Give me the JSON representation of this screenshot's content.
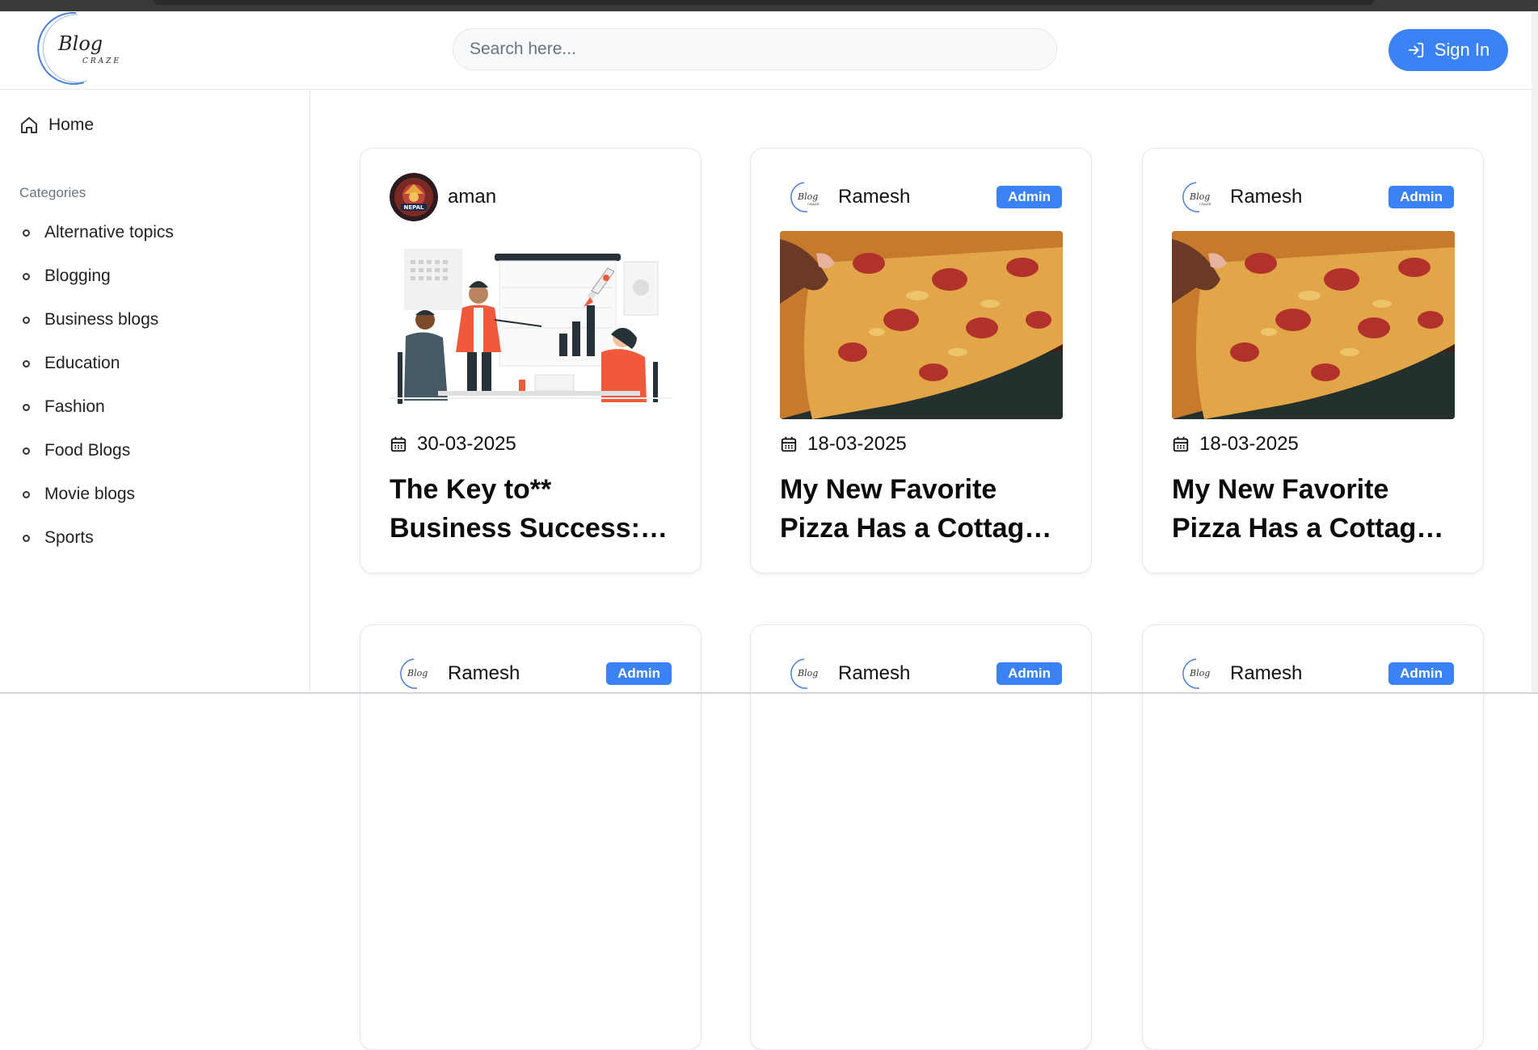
{
  "header": {
    "logo_text": "Blog",
    "logo_sub": "CRAZE",
    "search_placeholder": "Search here...",
    "signin_label": "Sign In"
  },
  "sidebar": {
    "home_label": "Home",
    "categories_title": "Categories",
    "categories": [
      "Alternative topics",
      "Blogging",
      "Business blogs",
      "Education",
      "Fashion",
      "Food Blogs",
      "Movie blogs",
      "Sports"
    ]
  },
  "posts": [
    {
      "author": "aman",
      "badge": "",
      "date": "30-03-2025",
      "title": "The Key to** Business Success: Strategies for Growth",
      "image": "business-illustration"
    },
    {
      "author": "Ramesh",
      "badge": "Admin",
      "date": "18-03-2025",
      "title": "My New Favorite Pizza Has a Cottage Cheese Crust",
      "image": "pizza-photo"
    },
    {
      "author": "Ramesh",
      "badge": "Admin",
      "date": "18-03-2025",
      "title": "My New Favorite Pizza Has a Cottage Cheese Crust",
      "image": "pizza-photo"
    },
    {
      "author": "Ramesh",
      "badge": "Admin",
      "date": "",
      "title": "",
      "image": ""
    },
    {
      "author": "Ramesh",
      "badge": "Admin",
      "date": "",
      "title": "",
      "image": ""
    },
    {
      "author": "Ramesh",
      "badge": "Admin",
      "date": "",
      "title": "",
      "image": ""
    }
  ],
  "colors": {
    "accent": "#3b82f6",
    "border": "#e5e7eb"
  }
}
